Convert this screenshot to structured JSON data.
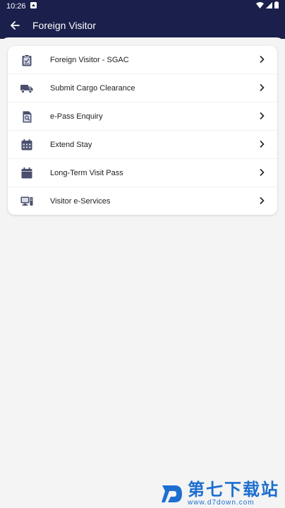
{
  "status_bar": {
    "time": "10:26"
  },
  "app_bar": {
    "title": "Foreign Visitor"
  },
  "menu": {
    "items": [
      {
        "label": "Foreign Visitor - SGAC",
        "icon": "clipboard-check-icon"
      },
      {
        "label": "Submit Cargo Clearance",
        "icon": "truck-icon"
      },
      {
        "label": "e-Pass Enquiry",
        "icon": "document-search-icon"
      },
      {
        "label": "Extend Stay",
        "icon": "calendar-grid-icon"
      },
      {
        "label": "Long-Term Visit Pass",
        "icon": "calendar-icon"
      },
      {
        "label": "Visitor e-Services",
        "icon": "computer-icon"
      }
    ]
  },
  "watermark": {
    "cn": "第七下载站",
    "url": "www.d7down.com"
  },
  "colors": {
    "app_bar": "#1b1f4b",
    "icon": "#4a4f6e",
    "watermark": "#1d6fcf"
  }
}
